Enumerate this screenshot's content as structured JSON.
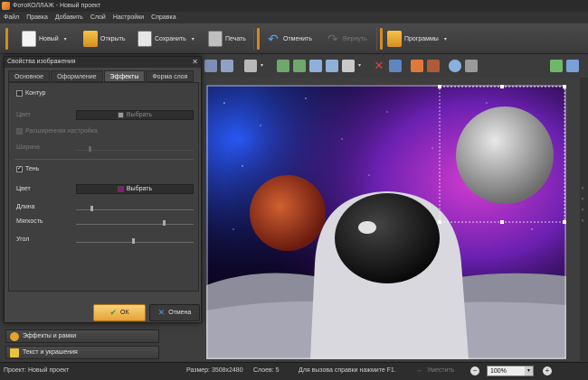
{
  "window": {
    "title": "ФотоКОЛЛАЖ - Новый проект"
  },
  "menu": [
    "Файл",
    "Правка",
    "Добавить",
    "Слой",
    "Настройки",
    "Справка"
  ],
  "toolbar": {
    "new_label": "Новый",
    "open_label": "Открыть",
    "save_label": "Сохранить",
    "print_label": "Печать",
    "undo_label": "Отменить",
    "redo_label": "Вернуть",
    "programs_label": "Программы"
  },
  "dialog": {
    "title": "Свойства изображения",
    "tabs": [
      "Основное",
      "Оформление",
      "Эффекты",
      "Форма слоя"
    ],
    "active_tab": "Эффекты",
    "contour": {
      "label": "Контур",
      "checked": false,
      "color_label": "Цвет",
      "color_button": "Выбрать",
      "color_swatch": "#9a9a9a",
      "advanced_label": "Расширенная настройка",
      "width_label": "Ширина"
    },
    "shadow": {
      "label": "Тень",
      "checked": true,
      "color_label": "Цвет",
      "color_button": "Выбрать",
      "color_swatch": "#8b1a7a",
      "length_label": "Длина",
      "softness_label": "Мягкость",
      "angle_label": "Угол"
    },
    "ok_label": "ОК",
    "cancel_label": "Отмена"
  },
  "side_panels": [
    "Эффекты и рамки",
    "Текст и украшения"
  ],
  "status": {
    "project": "Проект:  Новый проект",
    "size": "Размер:  3508x2480",
    "layers": "Слоев:  5",
    "help": "Для вызова справки нажмите F1.",
    "fit": "Уместить",
    "zoom": "100%"
  },
  "colors": {
    "accent": "#e8a23a",
    "panel": "#3a3a3a",
    "titlebar": "#2b2b2b"
  }
}
